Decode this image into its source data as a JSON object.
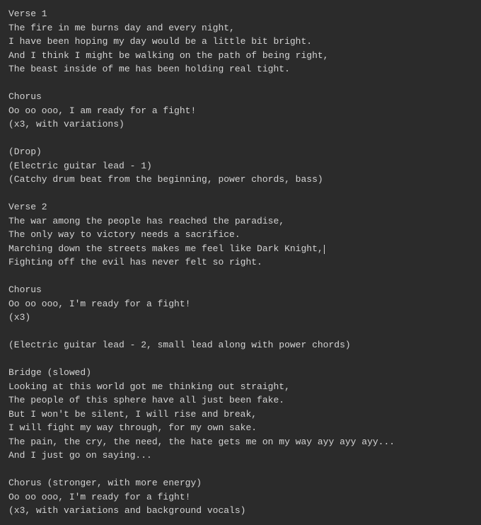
{
  "lyrics": {
    "lines": [
      "Verse 1",
      "The fire in me burns day and every night,",
      "I have been hoping my day would be a little bit bright.",
      "And I think I might be walking on the path of being right,",
      "The beast inside of me has been holding real tight.",
      "",
      "Chorus",
      "Oo oo ooo, I am ready for a fight!",
      "(x3, with variations)",
      "",
      "(Drop)",
      "(Electric guitar lead - 1)",
      "(Catchy drum beat from the beginning, power chords, bass)",
      "",
      "Verse 2",
      "The war among the people has reached the paradise,",
      "The only way to victory needs a sacrifice.",
      "Marching down the streets makes me feel like Dark Knight,",
      "Fighting off the evil has never felt so right.",
      "",
      "Chorus",
      "Oo oo ooo, I'm ready for a fight!",
      "(x3)",
      "",
      "(Electric guitar lead - 2, small lead along with power chords)",
      "",
      "Bridge (slowed)",
      "Looking at this world got me thinking out straight,",
      "The people of this sphere have all just been fake.",
      "But I won't be silent, I will rise and break,",
      "I will fight my way through, for my own sake.",
      "The pain, the cry, the need, the hate gets me on my way ayy ayy ayy...",
      "And I just go on saying...",
      "",
      "Chorus (stronger, with more energy)",
      "Oo oo ooo, I'm ready for a fight!",
      "(x3, with variations and background vocals)"
    ],
    "cursor_line_index": 17
  }
}
